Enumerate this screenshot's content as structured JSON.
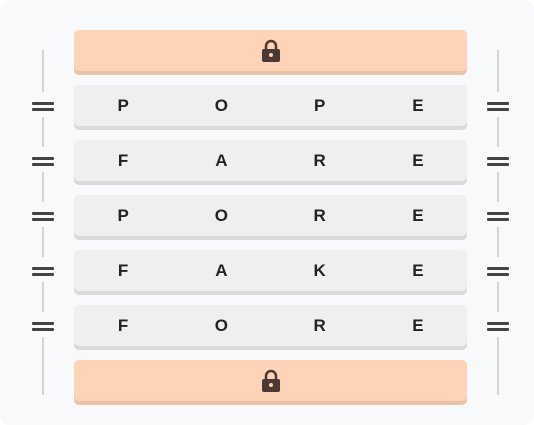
{
  "rows": [
    [
      "P",
      "O",
      "P",
      "E"
    ],
    [
      "F",
      "A",
      "R",
      "E"
    ],
    [
      "P",
      "O",
      "R",
      "E"
    ],
    [
      "F",
      "A",
      "K",
      "E"
    ],
    [
      "F",
      "O",
      "R",
      "E"
    ]
  ],
  "colors": {
    "lock": "#ffd3b8",
    "row": "#efefef"
  },
  "icons": {
    "lock": "lock-icon",
    "handle": "drag-handle-icon"
  }
}
